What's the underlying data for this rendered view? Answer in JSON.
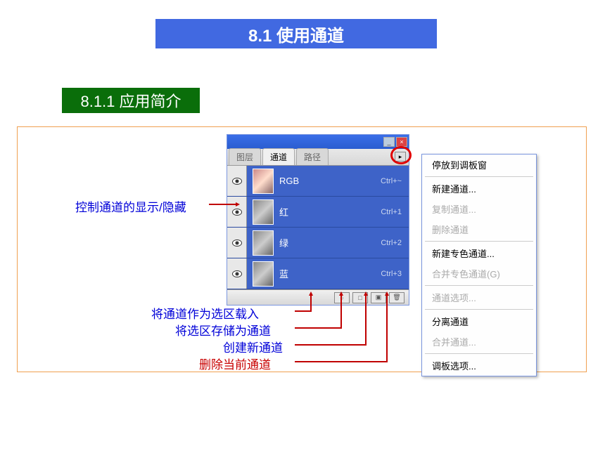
{
  "title": "8.1 使用通道",
  "subtitle": "8.1.1 应用简介",
  "panel": {
    "tabs": [
      {
        "label": "图层",
        "active": false
      },
      {
        "label": "通道",
        "active": true
      },
      {
        "label": "路径",
        "active": false
      }
    ],
    "channels": [
      {
        "name": "RGB",
        "shortcut": "Ctrl+~",
        "rgb": true
      },
      {
        "name": "红",
        "shortcut": "Ctrl+1",
        "rgb": false
      },
      {
        "name": "绿",
        "shortcut": "Ctrl+2",
        "rgb": false
      },
      {
        "name": "蓝",
        "shortcut": "Ctrl+3",
        "rgb": false
      }
    ],
    "footer_icons": [
      "○",
      "□",
      "▣",
      "🗑"
    ]
  },
  "context_menu": [
    {
      "label": "停放到调板窗",
      "disabled": false
    },
    {
      "sep": true
    },
    {
      "label": "新建通道...",
      "disabled": false
    },
    {
      "label": "复制通道...",
      "disabled": true
    },
    {
      "label": "删除通道",
      "disabled": true
    },
    {
      "sep": true
    },
    {
      "label": "新建专色通道...",
      "disabled": false
    },
    {
      "label": "合并专色通道(G)",
      "disabled": true
    },
    {
      "sep": true
    },
    {
      "label": "通道选项...",
      "disabled": true
    },
    {
      "sep": true
    },
    {
      "label": "分离通道",
      "disabled": false
    },
    {
      "label": "合并通道...",
      "disabled": true
    },
    {
      "sep": true
    },
    {
      "label": "调板选项...",
      "disabled": false
    }
  ],
  "annotations": {
    "visibility": "控制通道的显示/隐藏",
    "load_sel": "将通道作为选区载入",
    "save_sel": "将选区存储为通道",
    "new_channel": "创建新通道",
    "delete_channel": "删除当前通道"
  }
}
